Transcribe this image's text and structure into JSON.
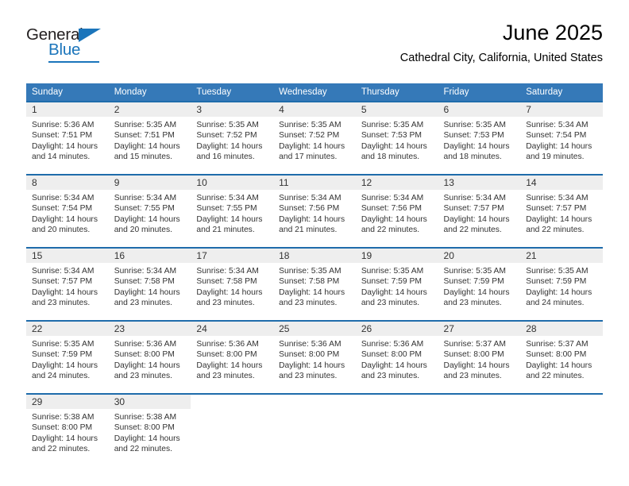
{
  "brand": {
    "name_dark": "General",
    "name_blue": "Blue",
    "accent_color": "#1b75bb"
  },
  "header": {
    "title": "June 2025",
    "subtitle": "Cathedral City, California, United States",
    "header_bg_color": "#3579b8",
    "row_border_color": "#1f6cab",
    "daynum_band_color": "#eeeeee"
  },
  "weekday_headers": [
    "Sunday",
    "Monday",
    "Tuesday",
    "Wednesday",
    "Thursday",
    "Friday",
    "Saturday"
  ],
  "weeks": [
    [
      {
        "day": "1",
        "sunrise": "Sunrise: 5:36 AM",
        "sunset": "Sunset: 7:51 PM",
        "daylight": "Daylight: 14 hours and 14 minutes."
      },
      {
        "day": "2",
        "sunrise": "Sunrise: 5:35 AM",
        "sunset": "Sunset: 7:51 PM",
        "daylight": "Daylight: 14 hours and 15 minutes."
      },
      {
        "day": "3",
        "sunrise": "Sunrise: 5:35 AM",
        "sunset": "Sunset: 7:52 PM",
        "daylight": "Daylight: 14 hours and 16 minutes."
      },
      {
        "day": "4",
        "sunrise": "Sunrise: 5:35 AM",
        "sunset": "Sunset: 7:52 PM",
        "daylight": "Daylight: 14 hours and 17 minutes."
      },
      {
        "day": "5",
        "sunrise": "Sunrise: 5:35 AM",
        "sunset": "Sunset: 7:53 PM",
        "daylight": "Daylight: 14 hours and 18 minutes."
      },
      {
        "day": "6",
        "sunrise": "Sunrise: 5:35 AM",
        "sunset": "Sunset: 7:53 PM",
        "daylight": "Daylight: 14 hours and 18 minutes."
      },
      {
        "day": "7",
        "sunrise": "Sunrise: 5:34 AM",
        "sunset": "Sunset: 7:54 PM",
        "daylight": "Daylight: 14 hours and 19 minutes."
      }
    ],
    [
      {
        "day": "8",
        "sunrise": "Sunrise: 5:34 AM",
        "sunset": "Sunset: 7:54 PM",
        "daylight": "Daylight: 14 hours and 20 minutes."
      },
      {
        "day": "9",
        "sunrise": "Sunrise: 5:34 AM",
        "sunset": "Sunset: 7:55 PM",
        "daylight": "Daylight: 14 hours and 20 minutes."
      },
      {
        "day": "10",
        "sunrise": "Sunrise: 5:34 AM",
        "sunset": "Sunset: 7:55 PM",
        "daylight": "Daylight: 14 hours and 21 minutes."
      },
      {
        "day": "11",
        "sunrise": "Sunrise: 5:34 AM",
        "sunset": "Sunset: 7:56 PM",
        "daylight": "Daylight: 14 hours and 21 minutes."
      },
      {
        "day": "12",
        "sunrise": "Sunrise: 5:34 AM",
        "sunset": "Sunset: 7:56 PM",
        "daylight": "Daylight: 14 hours and 22 minutes."
      },
      {
        "day": "13",
        "sunrise": "Sunrise: 5:34 AM",
        "sunset": "Sunset: 7:57 PM",
        "daylight": "Daylight: 14 hours and 22 minutes."
      },
      {
        "day": "14",
        "sunrise": "Sunrise: 5:34 AM",
        "sunset": "Sunset: 7:57 PM",
        "daylight": "Daylight: 14 hours and 22 minutes."
      }
    ],
    [
      {
        "day": "15",
        "sunrise": "Sunrise: 5:34 AM",
        "sunset": "Sunset: 7:57 PM",
        "daylight": "Daylight: 14 hours and 23 minutes."
      },
      {
        "day": "16",
        "sunrise": "Sunrise: 5:34 AM",
        "sunset": "Sunset: 7:58 PM",
        "daylight": "Daylight: 14 hours and 23 minutes."
      },
      {
        "day": "17",
        "sunrise": "Sunrise: 5:34 AM",
        "sunset": "Sunset: 7:58 PM",
        "daylight": "Daylight: 14 hours and 23 minutes."
      },
      {
        "day": "18",
        "sunrise": "Sunrise: 5:35 AM",
        "sunset": "Sunset: 7:58 PM",
        "daylight": "Daylight: 14 hours and 23 minutes."
      },
      {
        "day": "19",
        "sunrise": "Sunrise: 5:35 AM",
        "sunset": "Sunset: 7:59 PM",
        "daylight": "Daylight: 14 hours and 23 minutes."
      },
      {
        "day": "20",
        "sunrise": "Sunrise: 5:35 AM",
        "sunset": "Sunset: 7:59 PM",
        "daylight": "Daylight: 14 hours and 23 minutes."
      },
      {
        "day": "21",
        "sunrise": "Sunrise: 5:35 AM",
        "sunset": "Sunset: 7:59 PM",
        "daylight": "Daylight: 14 hours and 24 minutes."
      }
    ],
    [
      {
        "day": "22",
        "sunrise": "Sunrise: 5:35 AM",
        "sunset": "Sunset: 7:59 PM",
        "daylight": "Daylight: 14 hours and 24 minutes."
      },
      {
        "day": "23",
        "sunrise": "Sunrise: 5:36 AM",
        "sunset": "Sunset: 8:00 PM",
        "daylight": "Daylight: 14 hours and 23 minutes."
      },
      {
        "day": "24",
        "sunrise": "Sunrise: 5:36 AM",
        "sunset": "Sunset: 8:00 PM",
        "daylight": "Daylight: 14 hours and 23 minutes."
      },
      {
        "day": "25",
        "sunrise": "Sunrise: 5:36 AM",
        "sunset": "Sunset: 8:00 PM",
        "daylight": "Daylight: 14 hours and 23 minutes."
      },
      {
        "day": "26",
        "sunrise": "Sunrise: 5:36 AM",
        "sunset": "Sunset: 8:00 PM",
        "daylight": "Daylight: 14 hours and 23 minutes."
      },
      {
        "day": "27",
        "sunrise": "Sunrise: 5:37 AM",
        "sunset": "Sunset: 8:00 PM",
        "daylight": "Daylight: 14 hours and 23 minutes."
      },
      {
        "day": "28",
        "sunrise": "Sunrise: 5:37 AM",
        "sunset": "Sunset: 8:00 PM",
        "daylight": "Daylight: 14 hours and 22 minutes."
      }
    ],
    [
      {
        "day": "29",
        "sunrise": "Sunrise: 5:38 AM",
        "sunset": "Sunset: 8:00 PM",
        "daylight": "Daylight: 14 hours and 22 minutes."
      },
      {
        "day": "30",
        "sunrise": "Sunrise: 5:38 AM",
        "sunset": "Sunset: 8:00 PM",
        "daylight": "Daylight: 14 hours and 22 minutes."
      },
      {
        "day": "",
        "sunrise": "",
        "sunset": "",
        "daylight": ""
      },
      {
        "day": "",
        "sunrise": "",
        "sunset": "",
        "daylight": ""
      },
      {
        "day": "",
        "sunrise": "",
        "sunset": "",
        "daylight": ""
      },
      {
        "day": "",
        "sunrise": "",
        "sunset": "",
        "daylight": ""
      },
      {
        "day": "",
        "sunrise": "",
        "sunset": "",
        "daylight": ""
      }
    ]
  ]
}
